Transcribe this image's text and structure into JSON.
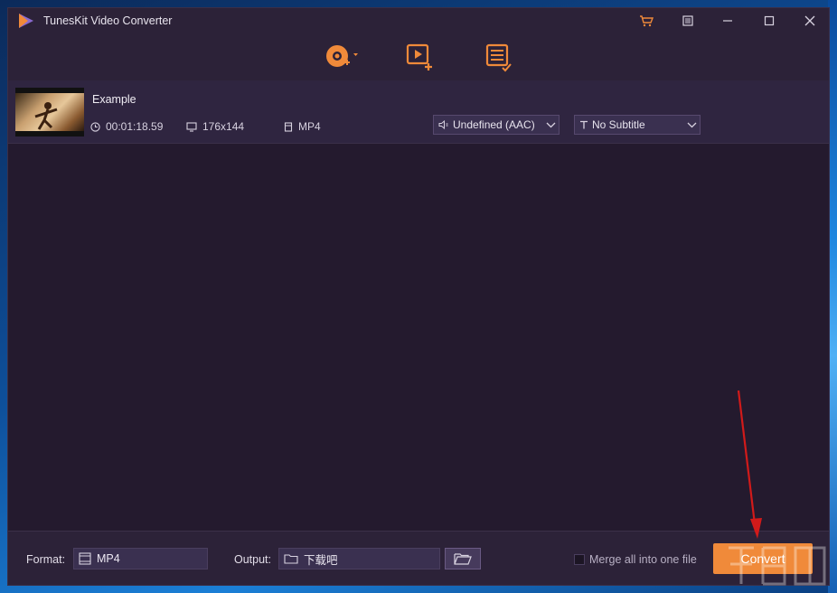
{
  "window": {
    "title": "TunesKit Video Converter"
  },
  "file": {
    "name": "Example",
    "duration": "00:01:18.59",
    "resolution": "176x144",
    "format": "MP4",
    "audio_track": "Undefined (AAC)",
    "subtitle": "No Subtitle"
  },
  "bottom": {
    "format_label": "Format:",
    "format_value": "MP4",
    "output_label": "Output:",
    "output_value": "下载吧",
    "merge_label": "Merge all into one file",
    "merge_checked": false,
    "convert_label": "Convert"
  },
  "colors": {
    "accent": "#f08a3a",
    "window_bg": "#241a2e",
    "bar_bg": "#2c2238",
    "annotation_arrow": "#d11a1a"
  },
  "icons": {
    "toolbar": [
      "add-dvd-icon",
      "add-video-icon",
      "converted-list-icon"
    ],
    "titlebar": [
      "cart-icon",
      "menu-icon",
      "minimize-icon",
      "maximize-icon",
      "close-icon"
    ]
  }
}
